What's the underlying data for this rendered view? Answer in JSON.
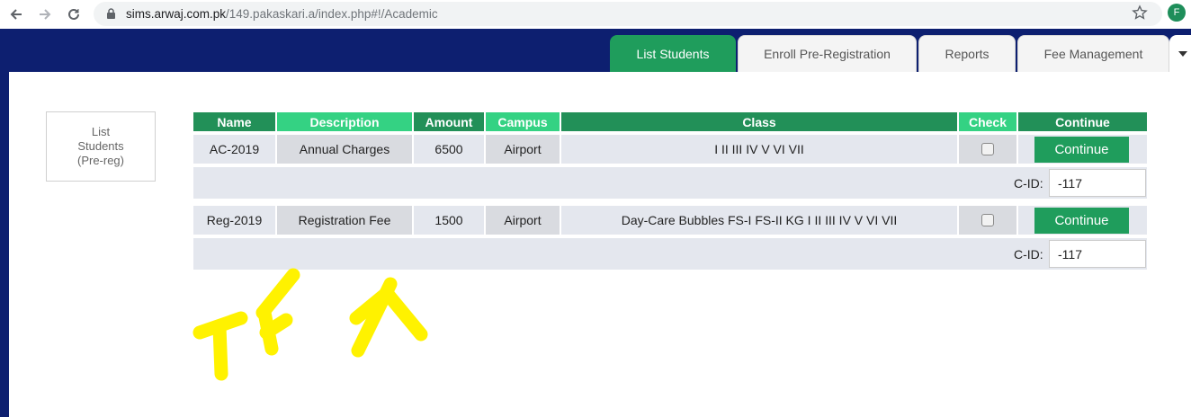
{
  "browser": {
    "url_domain": "sims.arwaj.com.pk",
    "url_path": "/149.pakaskari.a/index.php#!/Academic",
    "profile_initial": "F"
  },
  "tabs": [
    {
      "label": "List Students",
      "active": true
    },
    {
      "label": "Enroll Pre-Registration",
      "active": false
    },
    {
      "label": "Reports",
      "active": false
    },
    {
      "label": "Fee Management",
      "active": false
    }
  ],
  "side_box": {
    "line1": "List",
    "line2": "Students",
    "line3": "(Pre-reg)"
  },
  "table": {
    "headers": {
      "name": "Name",
      "description": "Description",
      "amount": "Amount",
      "campus": "Campus",
      "class": "Class",
      "check": "Check",
      "continue": "Continue"
    },
    "rows": [
      {
        "name": "AC-2019",
        "description": "Annual Charges",
        "amount": "6500",
        "campus": "Airport",
        "class": "I II III IV V VI VII",
        "checked": false,
        "button": "Continue",
        "cid_label": "C-ID:",
        "cid_value": "-117"
      },
      {
        "name": "Reg-2019",
        "description": "Registration Fee",
        "amount": "1500",
        "campus": "Airport",
        "class": "Day-Care Bubbles FS-I FS-II KG I II III IV V VI VII",
        "checked": false,
        "button": "Continue",
        "cid_label": "C-ID:",
        "cid_value": "-117"
      }
    ]
  },
  "colors": {
    "accent_green": "#1f9d5c",
    "header_dark": "#229058",
    "header_light": "#34d283",
    "frame_navy": "#0d1f70",
    "scribble_yellow": "#fff200"
  }
}
